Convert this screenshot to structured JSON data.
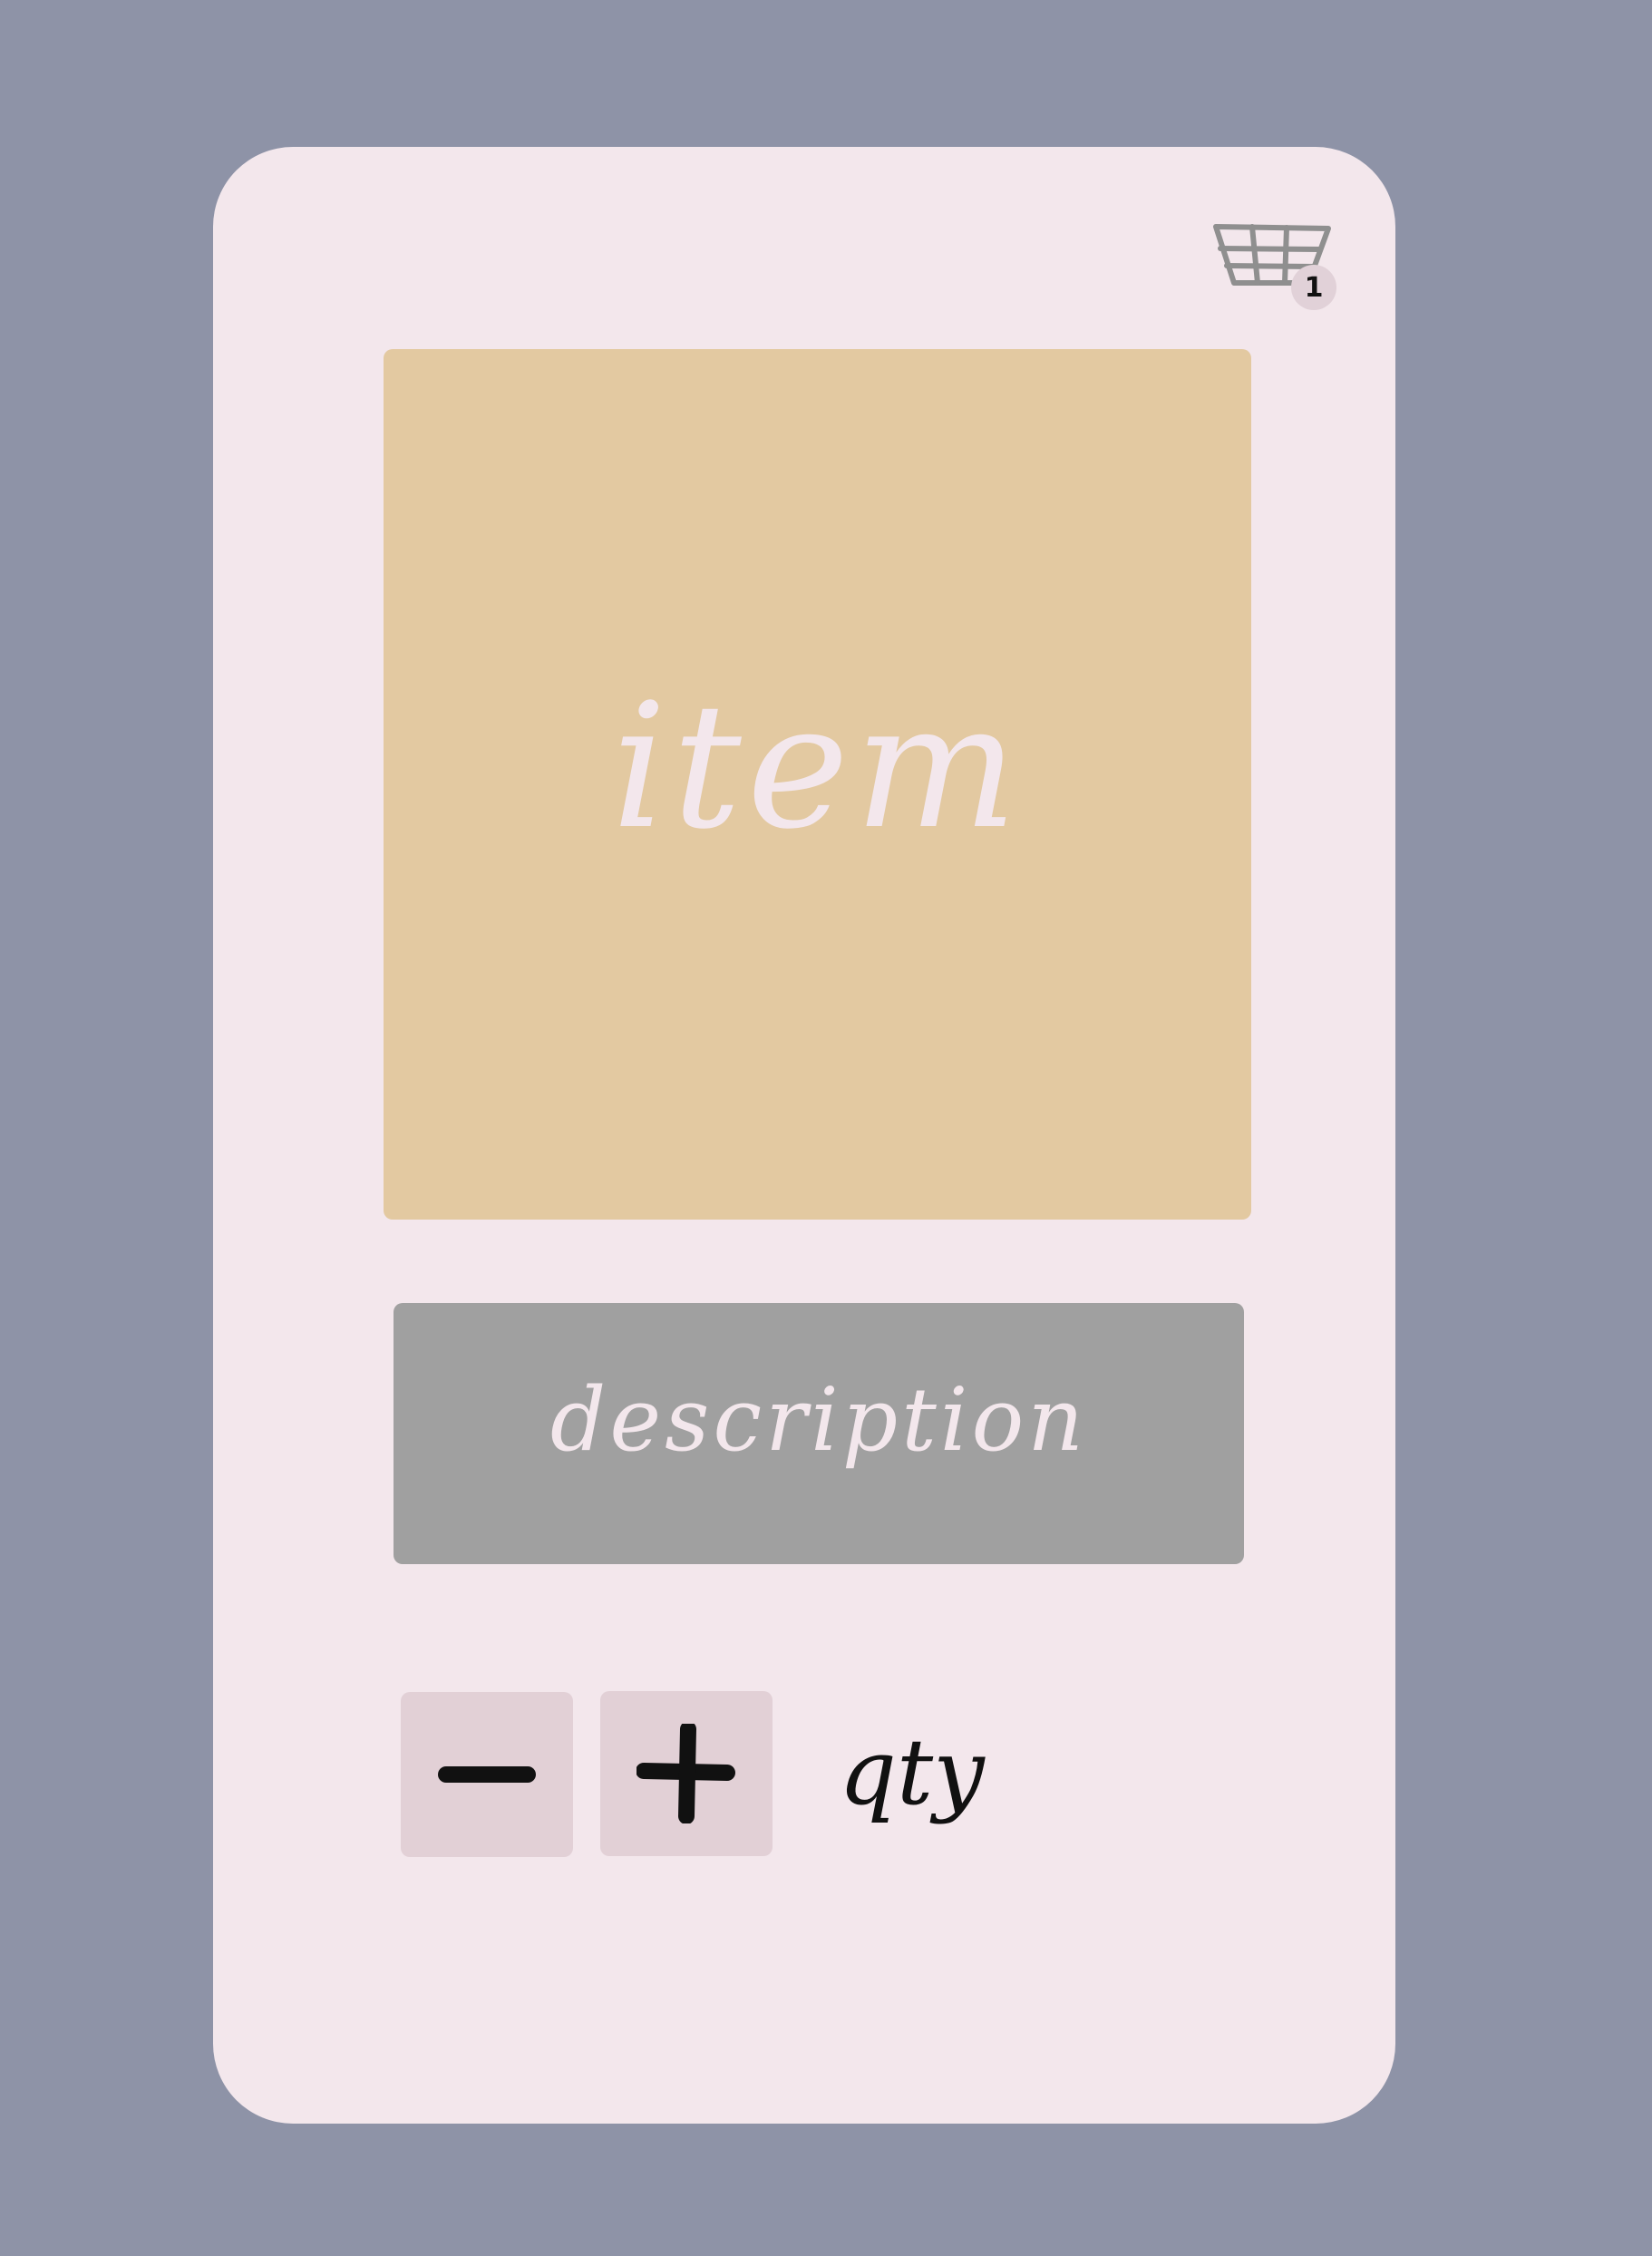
{
  "cart": {
    "icon": "basket-icon",
    "badge_count": "1"
  },
  "product": {
    "image_label": "item",
    "description_label": "description"
  },
  "quantity": {
    "decrement_icon": "minus-icon",
    "increment_icon": "plus-icon",
    "label": "qty"
  },
  "colors": {
    "background": "#8e93a7",
    "card": "#f3e7ec",
    "image_placeholder": "#e3c9a1",
    "description_box": "#a0a0a0",
    "button": "#e2d0d6"
  }
}
